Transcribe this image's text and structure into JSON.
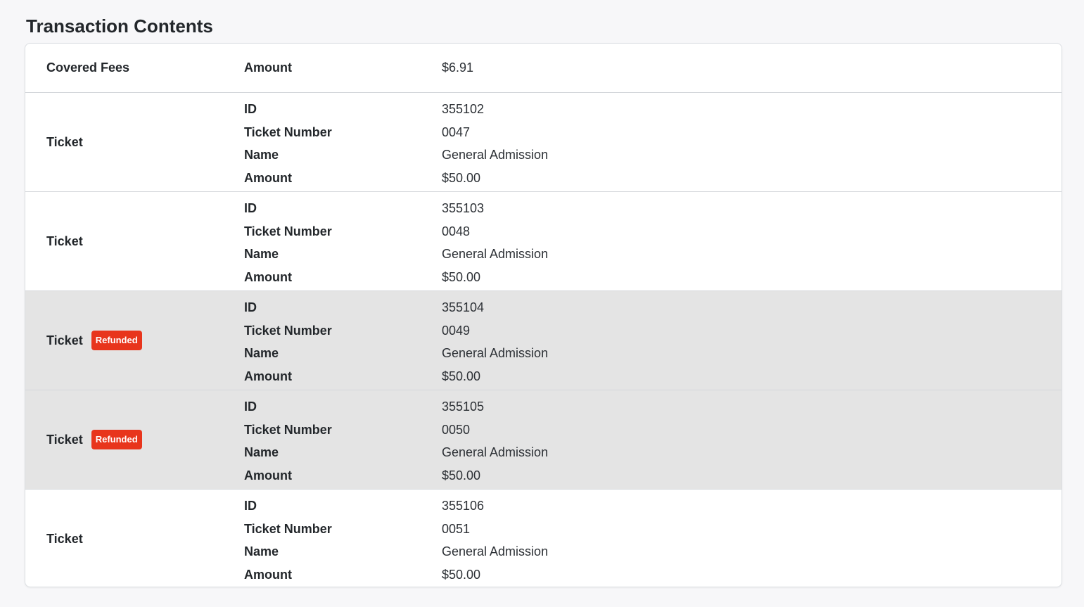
{
  "page": {
    "title": "Transaction Contents"
  },
  "fees": {
    "type_label": "Covered Fees",
    "amount_label": "Amount",
    "amount_value": "$6.91"
  },
  "field_labels": {
    "id": "ID",
    "ticket_number": "Ticket Number",
    "name": "Name",
    "amount": "Amount"
  },
  "tickets": [
    {
      "type_label": "Ticket",
      "badge": "",
      "id": "355102",
      "ticket_number": "0047",
      "name": "General Admission",
      "amount": "$50.00"
    },
    {
      "type_label": "Ticket",
      "badge": "",
      "id": "355103",
      "ticket_number": "0048",
      "name": "General Admission",
      "amount": "$50.00"
    },
    {
      "type_label": "Ticket",
      "badge": "Refunded",
      "id": "355104",
      "ticket_number": "0049",
      "name": "General Admission",
      "amount": "$50.00"
    },
    {
      "type_label": "Ticket",
      "badge": "Refunded",
      "id": "355105",
      "ticket_number": "0050",
      "name": "General Admission",
      "amount": "$50.00"
    },
    {
      "type_label": "Ticket",
      "badge": "",
      "id": "355106",
      "ticket_number": "0051",
      "name": "General Admission",
      "amount": "$50.00"
    }
  ],
  "colors": {
    "refunded_badge": "#e8351c",
    "refunded_row_bg": "#e4e4e4",
    "page_bg": "#f7f7f9"
  }
}
